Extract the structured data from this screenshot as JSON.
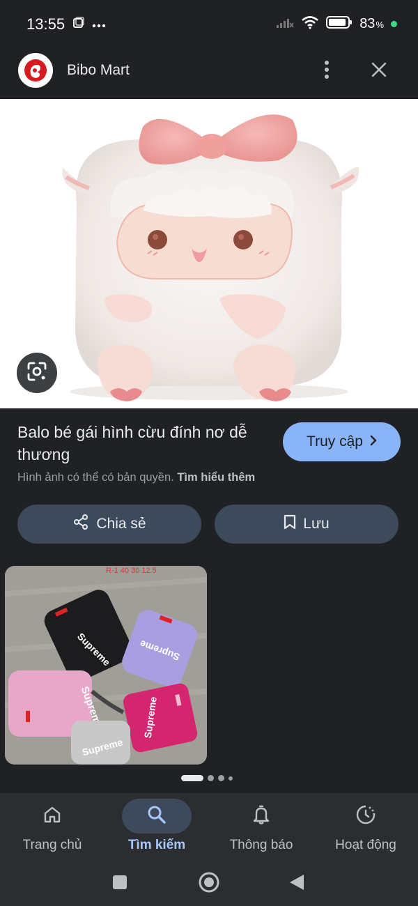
{
  "status_bar": {
    "time": "13:55",
    "battery": "83",
    "battery_unit": "%",
    "icons": [
      "screenshot-icon",
      "more-dots-icon",
      "signal-icon",
      "wifi-icon",
      "battery-icon"
    ]
  },
  "header": {
    "site_name": "Bibo Mart",
    "icons": [
      "bibo-mart-logo",
      "more-vert-icon",
      "close-icon"
    ]
  },
  "image": {
    "subject": "plush-sheep-backpack",
    "lens_icon": "google-lens-icon"
  },
  "result": {
    "title": "Balo bé gái hình cừu đính nơ dễ thương",
    "visit_label": "Truy cập",
    "copyright_text": "Hình ảnh có thể có bản quyền.",
    "learn_more": "Tìm hiểu thêm"
  },
  "actions": {
    "share_label": "Chia sẻ",
    "save_label": "Lưu"
  },
  "related": {
    "overlay_text": "R-1 40  30  12.5",
    "brand_text": "Supreme"
  },
  "pager": {
    "total": 4,
    "current": 1
  },
  "bottom_nav": {
    "items": [
      {
        "label": "Trang chủ",
        "icon": "home-icon",
        "active": false
      },
      {
        "label": "Tìm kiếm",
        "icon": "search-icon",
        "active": true
      },
      {
        "label": "Thông báo",
        "icon": "bell-icon",
        "active": false
      },
      {
        "label": "Hoạt động",
        "icon": "activity-icon",
        "active": false
      }
    ]
  },
  "colors": {
    "background": "#202124",
    "accent": "#8ab4f8",
    "button_bg": "#3c4a5c",
    "nav_bg": "#2b2d31"
  }
}
